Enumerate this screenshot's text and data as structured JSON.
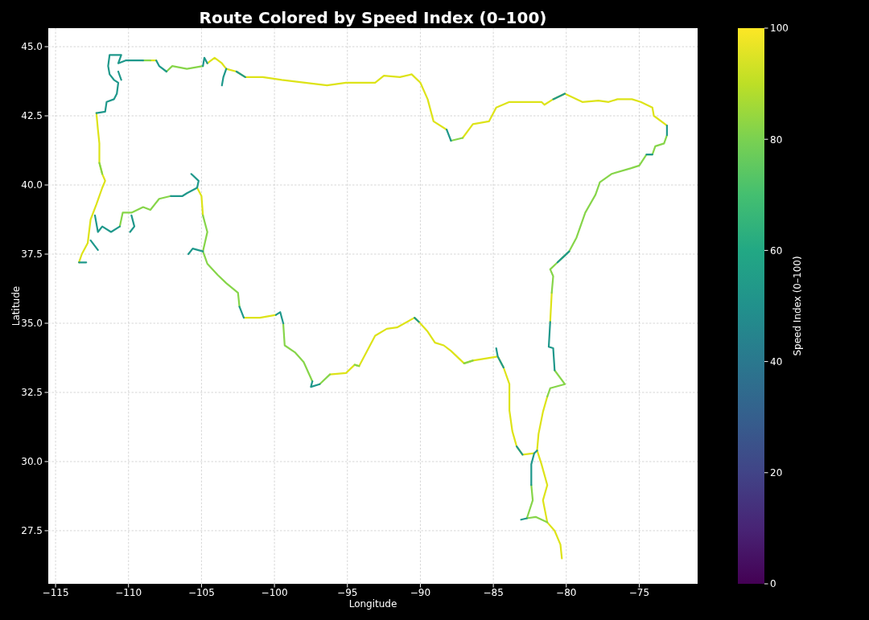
{
  "figure": {
    "chart_data": {
      "type": "line",
      "title": "Route Colored by Speed Index (0–100)",
      "xlabel": "Longitude",
      "ylabel": "Latitude",
      "grid": true,
      "x": [
        -113.4,
        -113.2,
        -112.8,
        -112.6,
        -112.2,
        -111.8,
        -111.6,
        -111.8,
        -112.0,
        -112.0,
        -112.1,
        -112.2,
        -111.6,
        -111.5,
        -111.0,
        -110.8,
        -110.7,
        -111.0,
        -111.3,
        -111.4,
        -111.3,
        -110.8,
        -110.5,
        -110.7,
        -110.2,
        -109.0,
        -108.5,
        -108.1,
        -107.9,
        -107.4,
        -107.0,
        -106.0,
        -104.9,
        -104.8,
        -104.6,
        -104.1,
        -103.6,
        -103.3,
        -102.6,
        -102.0,
        -100.8,
        -99.5,
        -97.9,
        -96.4,
        -95.1,
        -93.1,
        -92.5,
        -91.4,
        -90.6,
        -90.0,
        -89.5,
        -89.1,
        -88.2,
        -87.9,
        -87.1,
        -86.4,
        -85.3,
        -84.8,
        -83.9,
        -81.7,
        -81.5,
        -80.9,
        -80.1,
        -78.9,
        -77.8,
        -77.1,
        -76.5,
        -75.5,
        -74.9,
        -74.1,
        -74.0,
        -73.1,
        -73.1,
        -73.3,
        -73.9,
        -74.1,
        -74.5,
        -75.0,
        -75.6,
        -76.9,
        -77.7,
        -78.0,
        -78.7,
        -79.3,
        -79.8,
        -80.6,
        -81.1,
        -80.9,
        -81.0,
        -81.1,
        -81.2,
        -80.9,
        -80.8,
        -80.1,
        -81.1,
        -81.3,
        -81.6,
        -81.9,
        -82.0,
        -82.2,
        -82.4,
        -82.4,
        -82.3,
        -82.7,
        -82.1,
        -81.3,
        -80.8,
        -80.4,
        -80.3,
        null,
        -82.0,
        -81.7,
        -81.3,
        -81.6,
        -81.3,
        null,
        -112.3,
        -112.1,
        -111.8,
        -111.2,
        -110.6,
        -110.4,
        -109.8,
        -109.0,
        -108.5,
        -107.9,
        -107.1,
        -106.3,
        -106.0,
        -105.3,
        -105.0,
        -104.9,
        -104.6,
        -104.9,
        -104.6,
        -103.9,
        -103.3,
        -102.5,
        -102.4,
        -102.1,
        -101.0,
        -99.9,
        -99.6,
        -99.4,
        -99.3,
        -98.6,
        -98.0,
        -97.4,
        -97.5,
        -96.9,
        -96.2,
        -95.1,
        -94.5,
        -94.2,
        -93.1,
        -92.3,
        -91.6,
        -90.4,
        -90.1,
        -89.5,
        -89.0,
        -88.4,
        -87.9,
        -87.0,
        -86.4,
        -84.7,
        -84.3,
        -83.9,
        -83.9,
        -83.7,
        -83.4,
        -83.0,
        -82.2,
        null,
        -113.4,
        -112.9,
        null,
        -110.7,
        -110.5,
        null,
        -103.3,
        -103.5,
        -103.6,
        null,
        -112.6,
        -112.1,
        null,
        -109.8,
        -109.6,
        -109.9,
        null,
        -105.3,
        -105.2,
        -105.7,
        null,
        -104.9,
        -105.6,
        -105.9,
        null,
        -84.7,
        -84.8,
        null,
        -82.7,
        -83.1
      ],
      "series": [
        {
          "color": "#dde318",
          "values": [
            37.2,
            37.5,
            37.9,
            38.75,
            39.3,
            39.9,
            40.15,
            40.4,
            40.8,
            41.5,
            42.0,
            42.6,
            null,
            null,
            null,
            null,
            null,
            null,
            null,
            null,
            null,
            null,
            null,
            null,
            null,
            null,
            44.5,
            44.5,
            null,
            null,
            null,
            null,
            null,
            null,
            44.4,
            44.6,
            44.4,
            44.2,
            44.1,
            43.9,
            43.9,
            43.8,
            43.7,
            43.6,
            43.7,
            43.7,
            43.95,
            43.9,
            44.0,
            43.7,
            43.1,
            42.3,
            42.0,
            null,
            41.7,
            42.2,
            42.3,
            42.8,
            43.0,
            43.0,
            42.9,
            43.1,
            43.3,
            43.0,
            43.05,
            43.0,
            43.1,
            43.1,
            43.0,
            42.8,
            42.5,
            42.15,
            null,
            null,
            null,
            null,
            null,
            null,
            null,
            null,
            null,
            null,
            null,
            null,
            null,
            null,
            null,
            null,
            36.1,
            35.05,
            null,
            null,
            null,
            null,
            null,
            32.35,
            31.8,
            31.0,
            30.4,
            null,
            null,
            null,
            null,
            null,
            null,
            27.8,
            27.5,
            27.0,
            26.5,
            null,
            30.4,
            29.9,
            29.15,
            28.6,
            27.8,
            null,
            null,
            null,
            null,
            null,
            null,
            null,
            null,
            null,
            null,
            null,
            null,
            null,
            null,
            39.9,
            39.6,
            38.9,
            null,
            null,
            null,
            null,
            null,
            null,
            null,
            35.2,
            35.2,
            35.3,
            null,
            null,
            null,
            null,
            null,
            null,
            null,
            null,
            33.15,
            33.2,
            33.5,
            33.45,
            34.55,
            34.8,
            34.85,
            35.2,
            35.05,
            34.7,
            34.3,
            34.2,
            34.0,
            33.55,
            33.65,
            33.8,
            33.4,
            32.8,
            31.85,
            31.1,
            30.55,
            30.25,
            30.3,
            null,
            null,
            null,
            null,
            null,
            null,
            null,
            null,
            null,
            null,
            null,
            null,
            null,
            null,
            null,
            null,
            null,
            null,
            null,
            null,
            null,
            null,
            null,
            null,
            null,
            null,
            null,
            null,
            null,
            null,
            null
          ]
        },
        {
          "color": "#86d549",
          "values": [
            null,
            null,
            null,
            null,
            null,
            null,
            null,
            40.4,
            40.8,
            null,
            null,
            null,
            null,
            null,
            null,
            null,
            null,
            null,
            null,
            null,
            null,
            null,
            null,
            null,
            null,
            44.5,
            44.5,
            null,
            null,
            44.1,
            44.3,
            44.2,
            44.3,
            null,
            null,
            null,
            null,
            null,
            null,
            null,
            null,
            null,
            null,
            null,
            null,
            null,
            null,
            null,
            null,
            null,
            null,
            null,
            null,
            41.6,
            41.7,
            null,
            null,
            null,
            null,
            null,
            null,
            null,
            null,
            null,
            null,
            null,
            null,
            null,
            null,
            null,
            null,
            null,
            41.8,
            41.5,
            41.4,
            41.1,
            41.1,
            40.7,
            40.6,
            40.4,
            40.1,
            39.65,
            39.0,
            38.1,
            37.6,
            37.2,
            36.95,
            36.7,
            36.1,
            null,
            null,
            null,
            33.3,
            32.8,
            32.65,
            32.35,
            null,
            null,
            null,
            null,
            null,
            29.15,
            28.6,
            27.95,
            28.0,
            27.8,
            null,
            null,
            null,
            null,
            null,
            null,
            null,
            null,
            null,
            null,
            null,
            null,
            null,
            null,
            38.5,
            39.0,
            39.0,
            39.2,
            39.1,
            39.5,
            39.6,
            null,
            null,
            null,
            null,
            38.9,
            38.3,
            37.6,
            37.15,
            36.75,
            36.45,
            36.1,
            35.6,
            null,
            null,
            null,
            null,
            35.0,
            34.2,
            33.95,
            33.6,
            32.9,
            null,
            32.8,
            33.15,
            null,
            33.5,
            33.45,
            null,
            null,
            null,
            null,
            null,
            null,
            null,
            null,
            null,
            33.55,
            33.65,
            null,
            null,
            null,
            null,
            null,
            null,
            null,
            null,
            null,
            null,
            null,
            null,
            null,
            null,
            null,
            null,
            null,
            null,
            null,
            null,
            null,
            null,
            null,
            null,
            null,
            null,
            null,
            null,
            null,
            null,
            null,
            null,
            null,
            null,
            null,
            null,
            null,
            null,
            null
          ]
        },
        {
          "color": "#1f988b",
          "values": [
            null,
            null,
            null,
            null,
            null,
            null,
            null,
            null,
            null,
            null,
            null,
            42.6,
            42.65,
            43.0,
            43.1,
            43.3,
            43.7,
            43.8,
            44.0,
            44.3,
            44.7,
            44.7,
            44.7,
            44.4,
            44.5,
            44.5,
            null,
            44.5,
            44.3,
            44.1,
            null,
            null,
            44.3,
            44.6,
            44.4,
            null,
            null,
            null,
            44.1,
            43.9,
            null,
            null,
            null,
            null,
            null,
            null,
            null,
            null,
            null,
            null,
            null,
            null,
            42.0,
            41.6,
            null,
            null,
            null,
            null,
            null,
            null,
            null,
            43.1,
            43.3,
            null,
            null,
            null,
            null,
            null,
            null,
            null,
            null,
            42.15,
            41.8,
            null,
            null,
            41.1,
            41.1,
            null,
            null,
            null,
            null,
            null,
            null,
            null,
            37.6,
            37.2,
            null,
            null,
            null,
            35.05,
            34.15,
            34.1,
            33.3,
            null,
            null,
            null,
            null,
            null,
            30.4,
            30.3,
            29.9,
            29.15,
            null,
            null,
            null,
            null,
            null,
            null,
            null,
            null,
            null,
            null,
            null,
            null,
            null,
            null,
            38.9,
            38.3,
            38.5,
            38.3,
            38.5,
            null,
            null,
            null,
            null,
            null,
            39.6,
            39.6,
            39.7,
            39.9,
            null,
            null,
            null,
            null,
            null,
            null,
            null,
            null,
            35.6,
            35.2,
            null,
            35.3,
            35.4,
            35.0,
            null,
            null,
            null,
            32.9,
            32.7,
            32.8,
            null,
            null,
            null,
            null,
            null,
            null,
            null,
            35.2,
            35.05,
            null,
            null,
            null,
            null,
            null,
            null,
            33.8,
            33.4,
            null,
            null,
            null,
            30.55,
            30.25,
            null,
            null,
            37.2,
            37.2,
            null,
            44.1,
            43.8,
            null,
            44.2,
            43.9,
            43.6,
            null,
            38.0,
            37.65,
            null,
            38.9,
            38.5,
            38.3,
            null,
            39.9,
            40.15,
            40.4,
            null,
            37.6,
            37.7,
            37.5,
            null,
            33.8,
            34.1,
            null,
            27.95,
            27.9
          ]
        }
      ],
      "xlim": [
        -115.5,
        -71.0
      ],
      "ylim": [
        25.58,
        45.67
      ],
      "xticks": [
        {
          "value": -115,
          "label": "−115"
        },
        {
          "value": -110,
          "label": "−110"
        },
        {
          "value": -105,
          "label": "−105"
        },
        {
          "value": -100,
          "label": "−100"
        },
        {
          "value": -95,
          "label": "−95"
        },
        {
          "value": -90,
          "label": "−90"
        },
        {
          "value": -85,
          "label": "−85"
        },
        {
          "value": -80,
          "label": "−80"
        },
        {
          "value": -75,
          "label": "−75"
        }
      ],
      "yticks": [
        {
          "value": 45,
          "label": "45.0"
        },
        {
          "value": 42.5,
          "label": "42.5"
        },
        {
          "value": 40,
          "label": "40.0"
        },
        {
          "value": 37.5,
          "label": "37.5"
        },
        {
          "value": 35,
          "label": "35.0"
        },
        {
          "value": 32.5,
          "label": "32.5"
        },
        {
          "value": 30,
          "label": "30.0"
        },
        {
          "value": 27.5,
          "label": "27.5"
        }
      ]
    },
    "colorbar": {
      "label": "Speed Index (0–100)",
      "ticks": [
        "100",
        "80",
        "60",
        "40",
        "20",
        "0"
      ]
    }
  }
}
